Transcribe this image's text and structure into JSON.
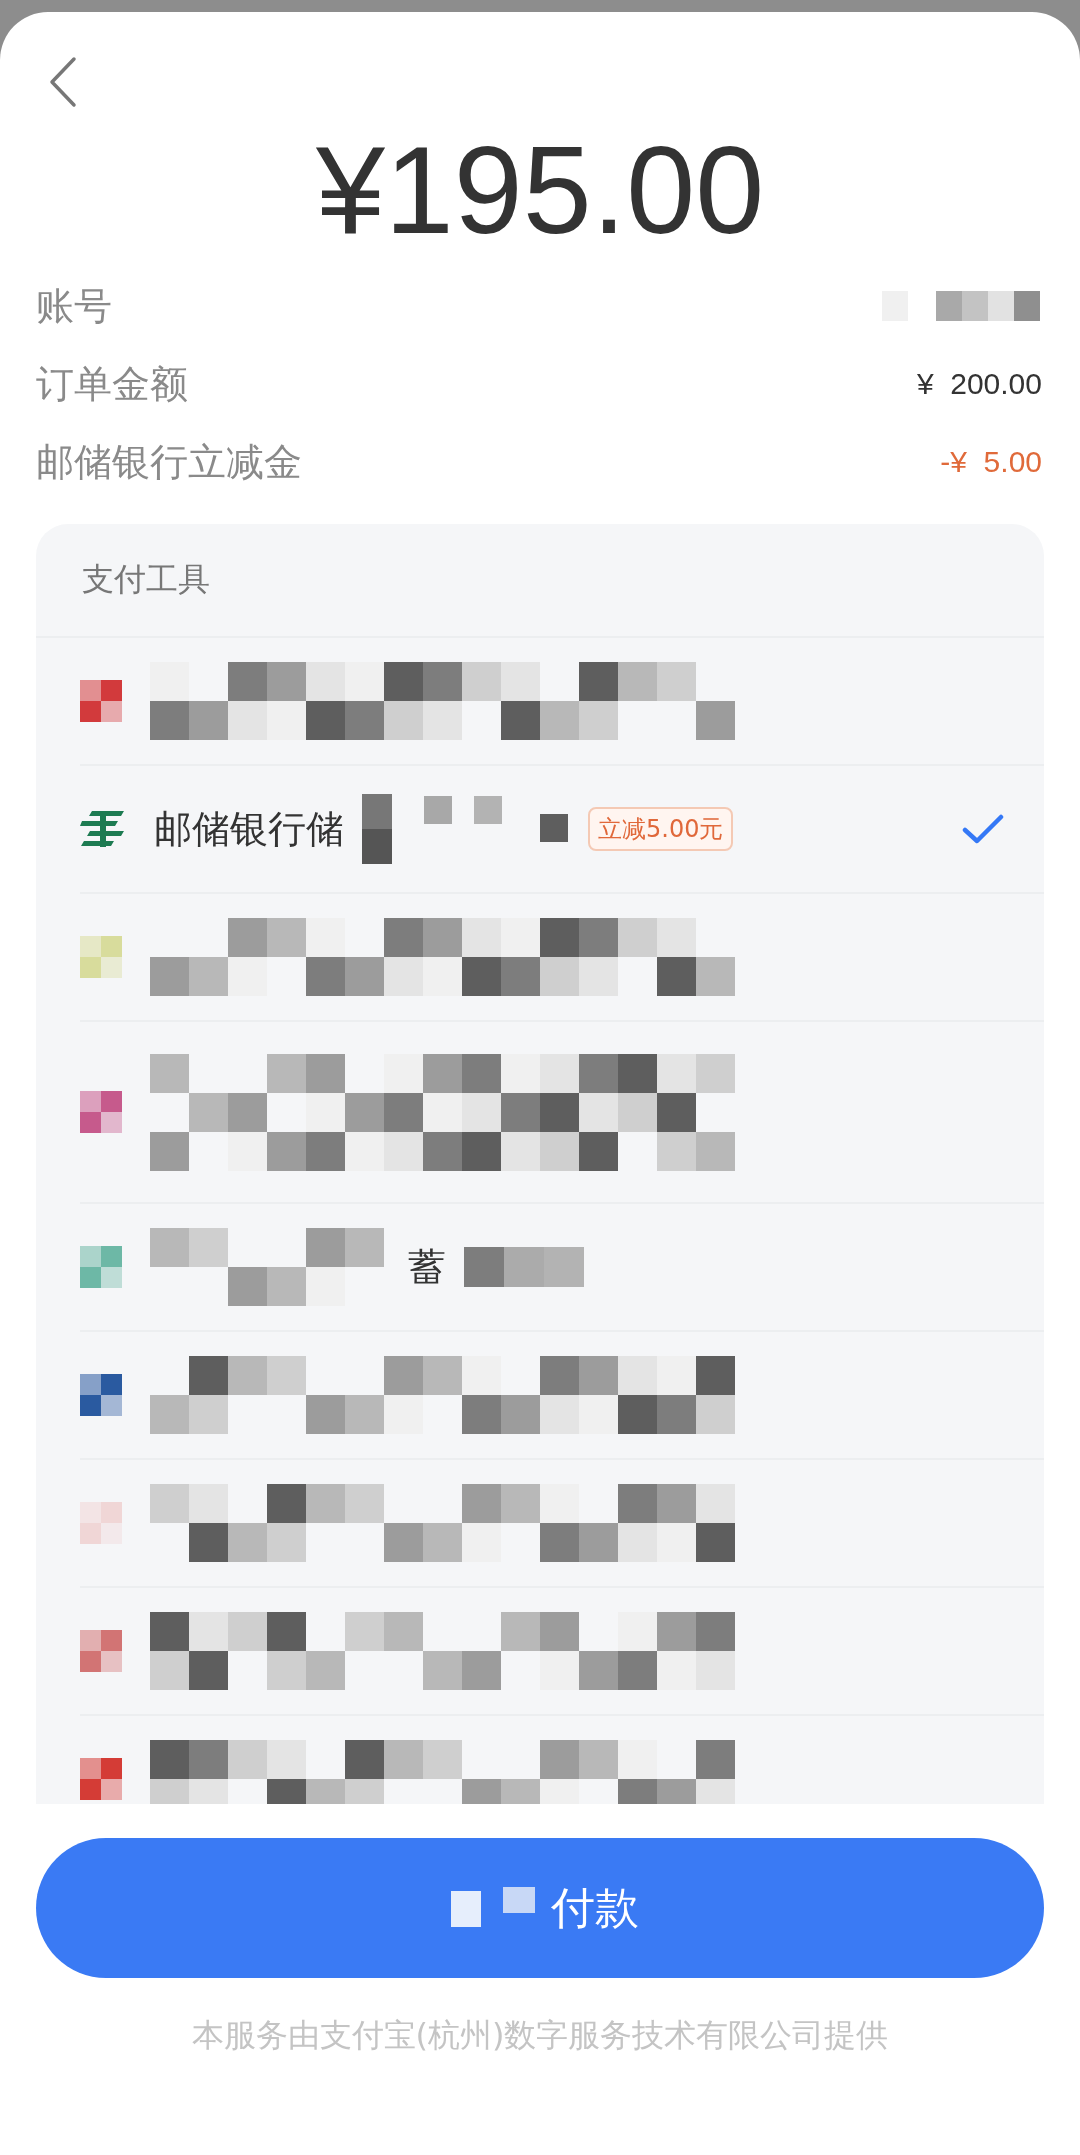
{
  "amount": "¥195.00",
  "details": [
    {
      "label": "账号",
      "kind": "masked"
    },
    {
      "label": "订单金额",
      "kind": "plain",
      "currency": "¥",
      "value": "200.00"
    },
    {
      "label": "邮储银行立减金",
      "kind": "discount",
      "currency": "-¥",
      "value": "5.00"
    }
  ],
  "payment_tools": {
    "title": "支付工具",
    "rows": [
      {
        "kind": "masked",
        "color": "#d23a3c",
        "selected": false
      },
      {
        "kind": "labeled",
        "label": "邮储银行储",
        "badge": "立减5.00元",
        "color": "#1d7b52",
        "selected": true
      },
      {
        "kind": "masked",
        "color": "#d8dc9c",
        "selected": false
      },
      {
        "kind": "tall",
        "color": "#c65a8c",
        "selected": false
      },
      {
        "kind": "partial",
        "label": "蓄",
        "color": "#6db8a6",
        "selected": false
      },
      {
        "kind": "masked",
        "color": "#2a5aa0",
        "selected": false
      },
      {
        "kind": "masked",
        "color": "#f0d6d6",
        "selected": false
      },
      {
        "kind": "masked",
        "color": "#d27474",
        "selected": false
      },
      {
        "kind": "masked",
        "color": "#d43c36",
        "selected": false
      }
    ]
  },
  "pay_button": {
    "label": "付款"
  },
  "footer": "本服务由支付宝(杭州)数字服务技术有限公司提供"
}
